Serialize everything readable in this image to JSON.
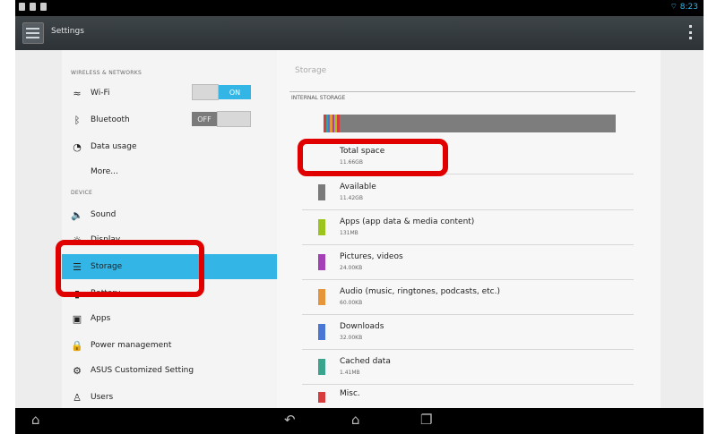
{
  "status": {
    "time": "8:23"
  },
  "app": {
    "title": "Settings"
  },
  "sidebar": {
    "wireless_header": "WIRELESS & NETWORKS",
    "device_header": "DEVICE",
    "items": [
      {
        "label": "Wi-Fi",
        "icon": "wifi-icon",
        "toggle": "ON"
      },
      {
        "label": "Bluetooth",
        "icon": "bluetooth-icon",
        "toggle": "OFF"
      },
      {
        "label": "Data usage",
        "icon": "data-usage-icon"
      },
      {
        "label": "More..."
      },
      {
        "label": "Sound",
        "icon": "sound-icon"
      },
      {
        "label": "Display",
        "icon": "display-icon"
      },
      {
        "label": "Storage",
        "icon": "storage-icon",
        "selected": true
      },
      {
        "label": "Battery",
        "icon": "battery-icon"
      },
      {
        "label": "Apps",
        "icon": "apps-icon"
      },
      {
        "label": "Power management",
        "icon": "power-icon"
      },
      {
        "label": "ASUS Customized Setting",
        "icon": "asus-gear-icon"
      },
      {
        "label": "Users",
        "icon": "users-icon"
      }
    ]
  },
  "storage": {
    "title": "Storage",
    "section": "INTERNAL STORAGE",
    "rows": [
      {
        "name": "Total space",
        "value": "11.66GB"
      },
      {
        "name": "Available",
        "value": "11.42GB",
        "color": "#7a7a7a"
      },
      {
        "name": "Apps (app data & media content)",
        "value": "131MB",
        "color": "#9bc51d"
      },
      {
        "name": "Pictures, videos",
        "value": "24.00KB",
        "color": "#a43fb8"
      },
      {
        "name": "Audio (music, ringtones, podcasts, etc.)",
        "value": "60.00KB",
        "color": "#e6953a"
      },
      {
        "name": "Downloads",
        "value": "32.00KB",
        "color": "#4a76d6"
      },
      {
        "name": "Cached data",
        "value": "1.41MB",
        "color": "#3aa58c"
      },
      {
        "name": "Misc.",
        "value": "",
        "color": "#d93c3c"
      }
    ]
  }
}
